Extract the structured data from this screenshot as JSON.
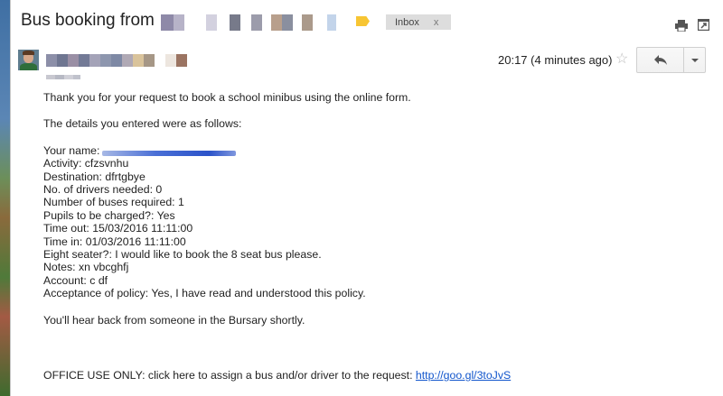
{
  "email": {
    "subject": "Bus booking from",
    "label": "Inbox",
    "label_remove": "x",
    "timestamp": "20:17 (4 minutes ago)",
    "body": {
      "intro": "Thank you for your request to book a school minibus using the online form.",
      "details_header": "The details you entered were as follows:",
      "name_label": "Your name:",
      "fields": [
        "Activity: cfzsvnhu",
        "Destination: dfrtgbye",
        "No. of drivers needed: 0",
        "Number of buses required: 1",
        "Pupils to be charged?: Yes",
        "Time out: 15/03/2016 11:11:00",
        "Time in: 01/03/2016 11:11:00",
        "Eight seater?: I would like to book the 8 seat bus please.",
        "Notes: xn vbcghfj",
        "Account: c df",
        "Acceptance of policy: Yes, I have read and understood this policy."
      ],
      "closing": "You'll hear back from someone in the Bursary shortly.",
      "office_text": "OFFICE USE ONLY: click here to assign a bus and/or driver to the request:",
      "office_link": "http://goo.gl/3toJvS"
    }
  },
  "icons": {
    "label": "label-icon",
    "print": "print-icon",
    "new_window": "new-window-icon",
    "star": "star-icon",
    "reply": "reply-icon",
    "more": "chevron-down-icon",
    "star_glyph": "☆"
  },
  "colors": {
    "label_tag": "#f7c533",
    "link": "#1155cc",
    "chip_bg": "#dddddd"
  }
}
